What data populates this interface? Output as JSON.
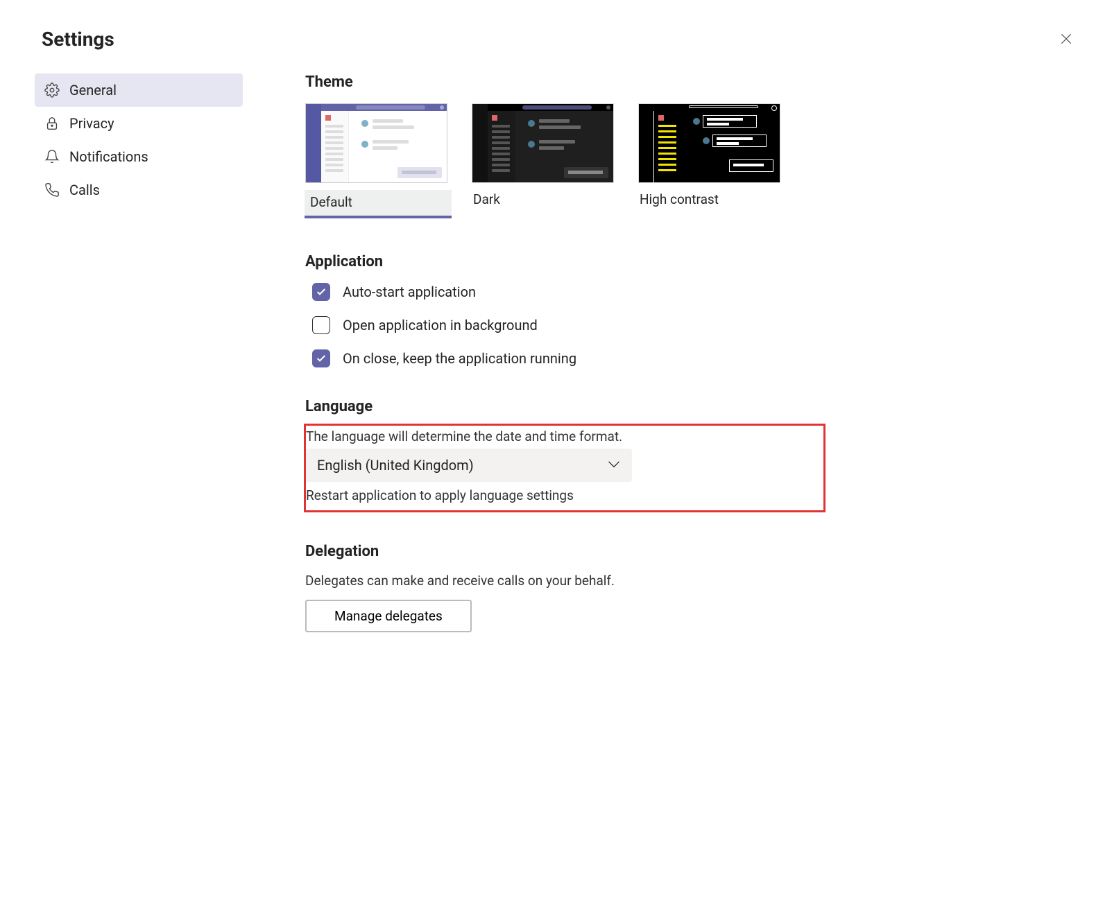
{
  "header": {
    "title": "Settings"
  },
  "sidebar": {
    "items": [
      {
        "label": "General"
      },
      {
        "label": "Privacy"
      },
      {
        "label": "Notifications"
      },
      {
        "label": "Calls"
      }
    ]
  },
  "theme": {
    "heading": "Theme",
    "options": [
      {
        "label": "Default"
      },
      {
        "label": "Dark"
      },
      {
        "label": "High contrast"
      }
    ]
  },
  "application": {
    "heading": "Application",
    "options": [
      {
        "label": "Auto-start application",
        "checked": true
      },
      {
        "label": "Open application in background",
        "checked": false
      },
      {
        "label": "On close, keep the application running",
        "checked": true
      }
    ]
  },
  "language": {
    "heading": "Language",
    "helper": "The language will determine the date and time format.",
    "selected": "English (United Kingdom)",
    "restart_note": "Restart application to apply language settings"
  },
  "delegation": {
    "heading": "Delegation",
    "helper": "Delegates can make and receive calls on your behalf.",
    "button": "Manage delegates"
  }
}
